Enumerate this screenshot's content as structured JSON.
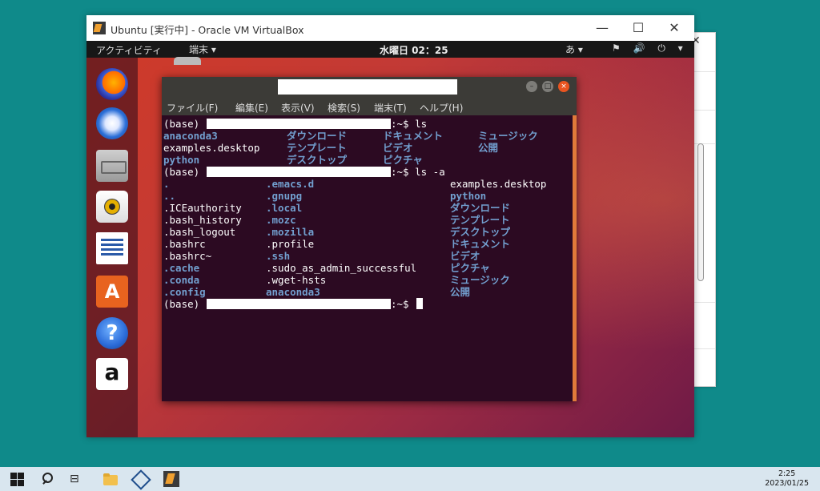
{
  "vbox": {
    "title": "Ubuntu [実行中] - Oracle VM VirtualBox",
    "min_glyph": "—",
    "max_glyph": "☐",
    "close_glyph": "✕"
  },
  "ubuntu_topbar": {
    "activities": "アクティビティ",
    "app_menu": "端末 ▾",
    "clock": "水曜日 02：25",
    "ime": "あ ▾",
    "tray": "⚑ 🔊 ⏻ ▾"
  },
  "dock": {
    "store_glyph": "A",
    "help_glyph": "?",
    "amazon_glyph": "a"
  },
  "terminal": {
    "menu": [
      "ファイル(F)",
      "編集(E)",
      "表示(V)",
      "検索(S)",
      "端末(T)",
      "ヘルプ(H)"
    ],
    "prompt_prefix": "(base)",
    "prompt_suffix_ls": ":~$ ls",
    "prompt_suffix_lsa": ":~$ ls -a",
    "prompt_suffix": ":~$",
    "ls_output": {
      "col1": [
        "anaconda3",
        "examples.desktop",
        "python"
      ],
      "col2": [
        "ダウンロード",
        "テンプレート",
        "デスクトップ"
      ],
      "col3": [
        "ドキュメント",
        "ビデオ",
        "ピクチャ"
      ],
      "col4": [
        "ミュージック",
        "公開"
      ]
    },
    "lsa_output": {
      "col1": [
        ".",
        "..",
        ".ICEauthority",
        ".bash_history",
        ".bash_logout",
        ".bashrc",
        ".bashrc~",
        ".cache",
        ".conda",
        ".config"
      ],
      "col2": [
        ".emacs.d",
        ".gnupg",
        ".local",
        ".mozc",
        ".mozilla",
        ".profile",
        ".ssh",
        ".sudo_as_admin_successful",
        ".wget-hsts",
        "anaconda3"
      ],
      "col3": [
        "examples.desktop",
        "python",
        "ダウンロード",
        "テンプレート",
        "デスクトップ",
        "ドキュメント",
        "ビデオ",
        "ピクチャ",
        "ミュージック",
        "公開"
      ]
    }
  },
  "taskbar": {
    "taskview_glyph": "⊟",
    "time": "2:25",
    "date": "2023/01/25"
  },
  "colors": {
    "terminal_bg": "#2c0a22",
    "directory_blue": "#729fcf",
    "ubuntu_orange": "#e95420",
    "desktop_teal": "#0f8a8a"
  }
}
